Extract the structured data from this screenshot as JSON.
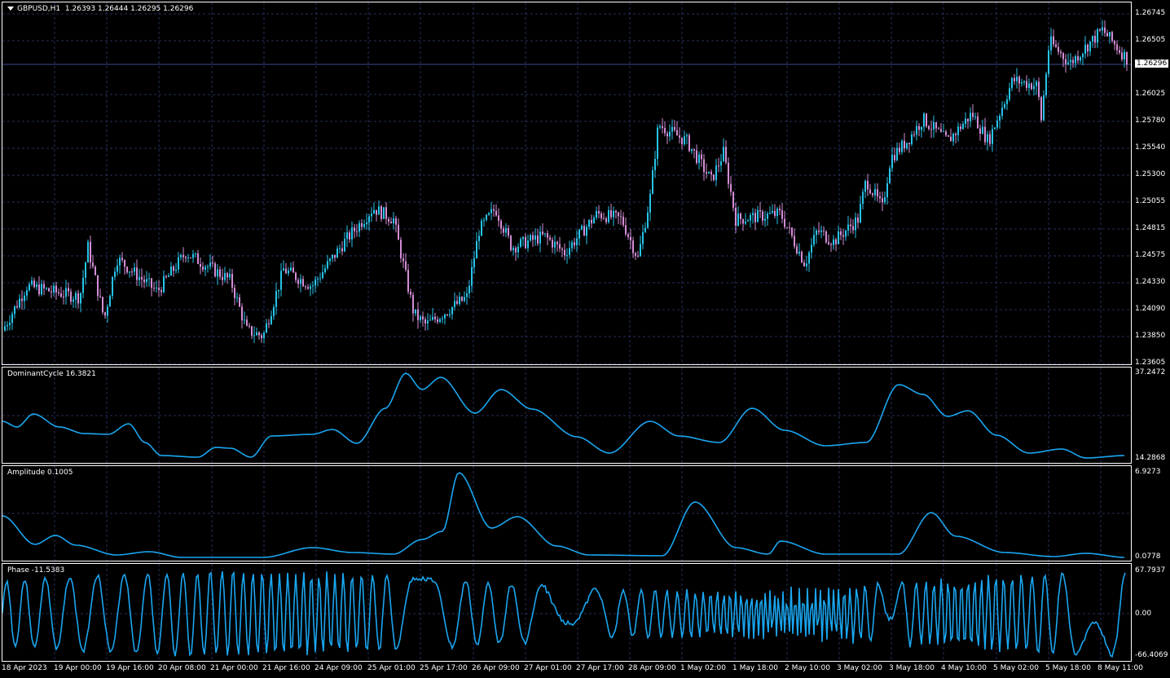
{
  "main": {
    "symbol": "GBPUSD,H1",
    "ohlc": "1.26393 1.26444 1.26295 1.26296",
    "current_price": "1.26296",
    "price_ticks": [
      "1.26745",
      "1.26505",
      "1.26296",
      "1.26025",
      "1.25780",
      "1.25540",
      "1.25300",
      "1.25055",
      "1.24815",
      "1.24575",
      "1.24330",
      "1.24090",
      "1.23850",
      "1.23605"
    ],
    "bull_color": "#27c4e8",
    "bear_color": "#d48ed6"
  },
  "dominant_cycle": {
    "title": "DominantCycle 16.3821",
    "max": "37.2472",
    "min": "14.2868",
    "color": "#1aa6f0"
  },
  "amplitude": {
    "title": "Amplitude 0.1005",
    "max": "6.9273",
    "min": "0.0778",
    "color": "#1aa6f0"
  },
  "phase": {
    "title": "Phase -11.5383",
    "max": "67.7937",
    "mid": "0.00",
    "min": "-66.4069",
    "color": "#1aa6f0"
  },
  "time_labels": [
    "18 Apr 2023",
    "19 Apr 00:00",
    "19 Apr 16:00",
    "20 Apr 08:00",
    "21 Apr 00:00",
    "21 Apr 16:00",
    "24 Apr 09:00",
    "25 Apr 01:00",
    "25 Apr 17:00",
    "26 Apr 09:00",
    "27 Apr 01:00",
    "27 Apr 17:00",
    "28 Apr 09:00",
    "1 May 02:00",
    "1 May 18:00",
    "2 May 10:00",
    "3 May 02:00",
    "3 May 18:00",
    "4 May 10:00",
    "5 May 02:00",
    "5 May 18:00",
    "8 May 11:00"
  ]
}
